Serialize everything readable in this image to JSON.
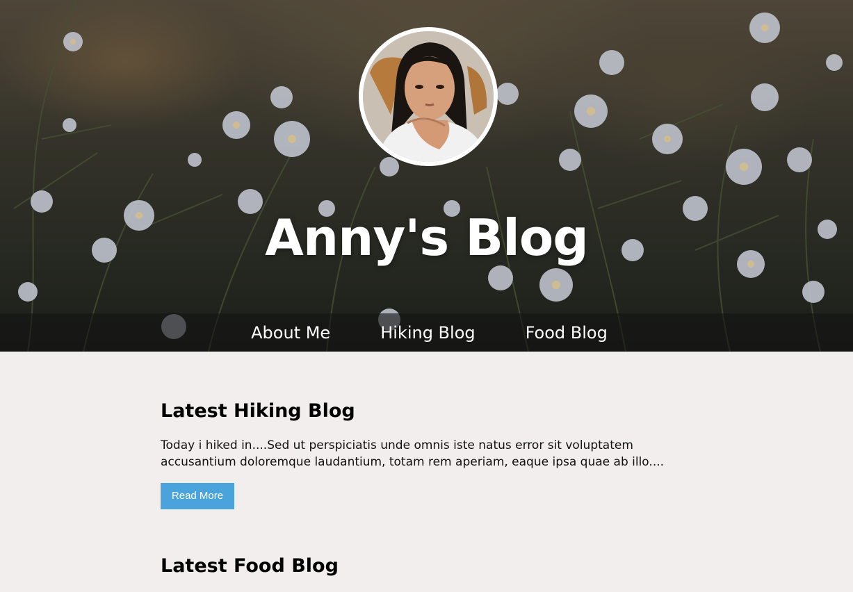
{
  "hero": {
    "title": "Anny's Blog"
  },
  "nav": {
    "items": [
      {
        "label": "About Me"
      },
      {
        "label": "Hiking Blog"
      },
      {
        "label": "Food Blog"
      }
    ]
  },
  "posts": [
    {
      "heading": "Latest Hiking Blog",
      "excerpt": "Today i hiked in....Sed ut perspiciatis unde omnis iste natus error sit voluptatem accusantium doloremque laudantium, totam rem aperiam, eaque ipsa quae ab illo....",
      "button_label": "Read More"
    },
    {
      "heading": "Latest Food Blog"
    }
  ],
  "colors": {
    "accent_button": "#4aa3db",
    "page_background": "#f2eeed",
    "nav_bar": "rgba(20,20,20,0.62)"
  }
}
